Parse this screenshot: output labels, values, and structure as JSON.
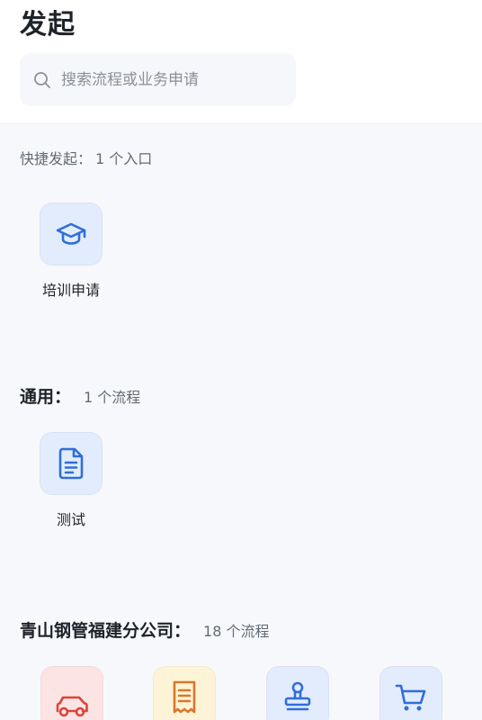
{
  "page": {
    "title": "发起"
  },
  "search": {
    "placeholder": "搜索流程或业务申请"
  },
  "quick_launch": {
    "label": "快捷发起：",
    "count": "1 个入口",
    "items": [
      {
        "label": "培训申请",
        "icon": "graduation-cap-icon"
      }
    ]
  },
  "groups": [
    {
      "title": "通用：",
      "count": "1 个流程",
      "items": [
        {
          "label": "测试",
          "icon": "document-icon"
        }
      ]
    },
    {
      "title": "青山钢管福建分公司：",
      "count": "18 个流程",
      "items": [
        {
          "label": "",
          "icon": "car-icon"
        },
        {
          "label": "",
          "icon": "receipt-icon"
        },
        {
          "label": "",
          "icon": "stamp-icon"
        },
        {
          "label": "",
          "icon": "shopping-cart-icon"
        }
      ]
    }
  ],
  "colors": {
    "accent": "#2f6fd9",
    "tile_blue": "#e3ecfc",
    "tile_red": "#fde4e4",
    "icon_red": "#d9453b",
    "tile_yellow": "#fdf3d6",
    "icon_orange": "#d9772b",
    "background": "#f7f8fc"
  }
}
